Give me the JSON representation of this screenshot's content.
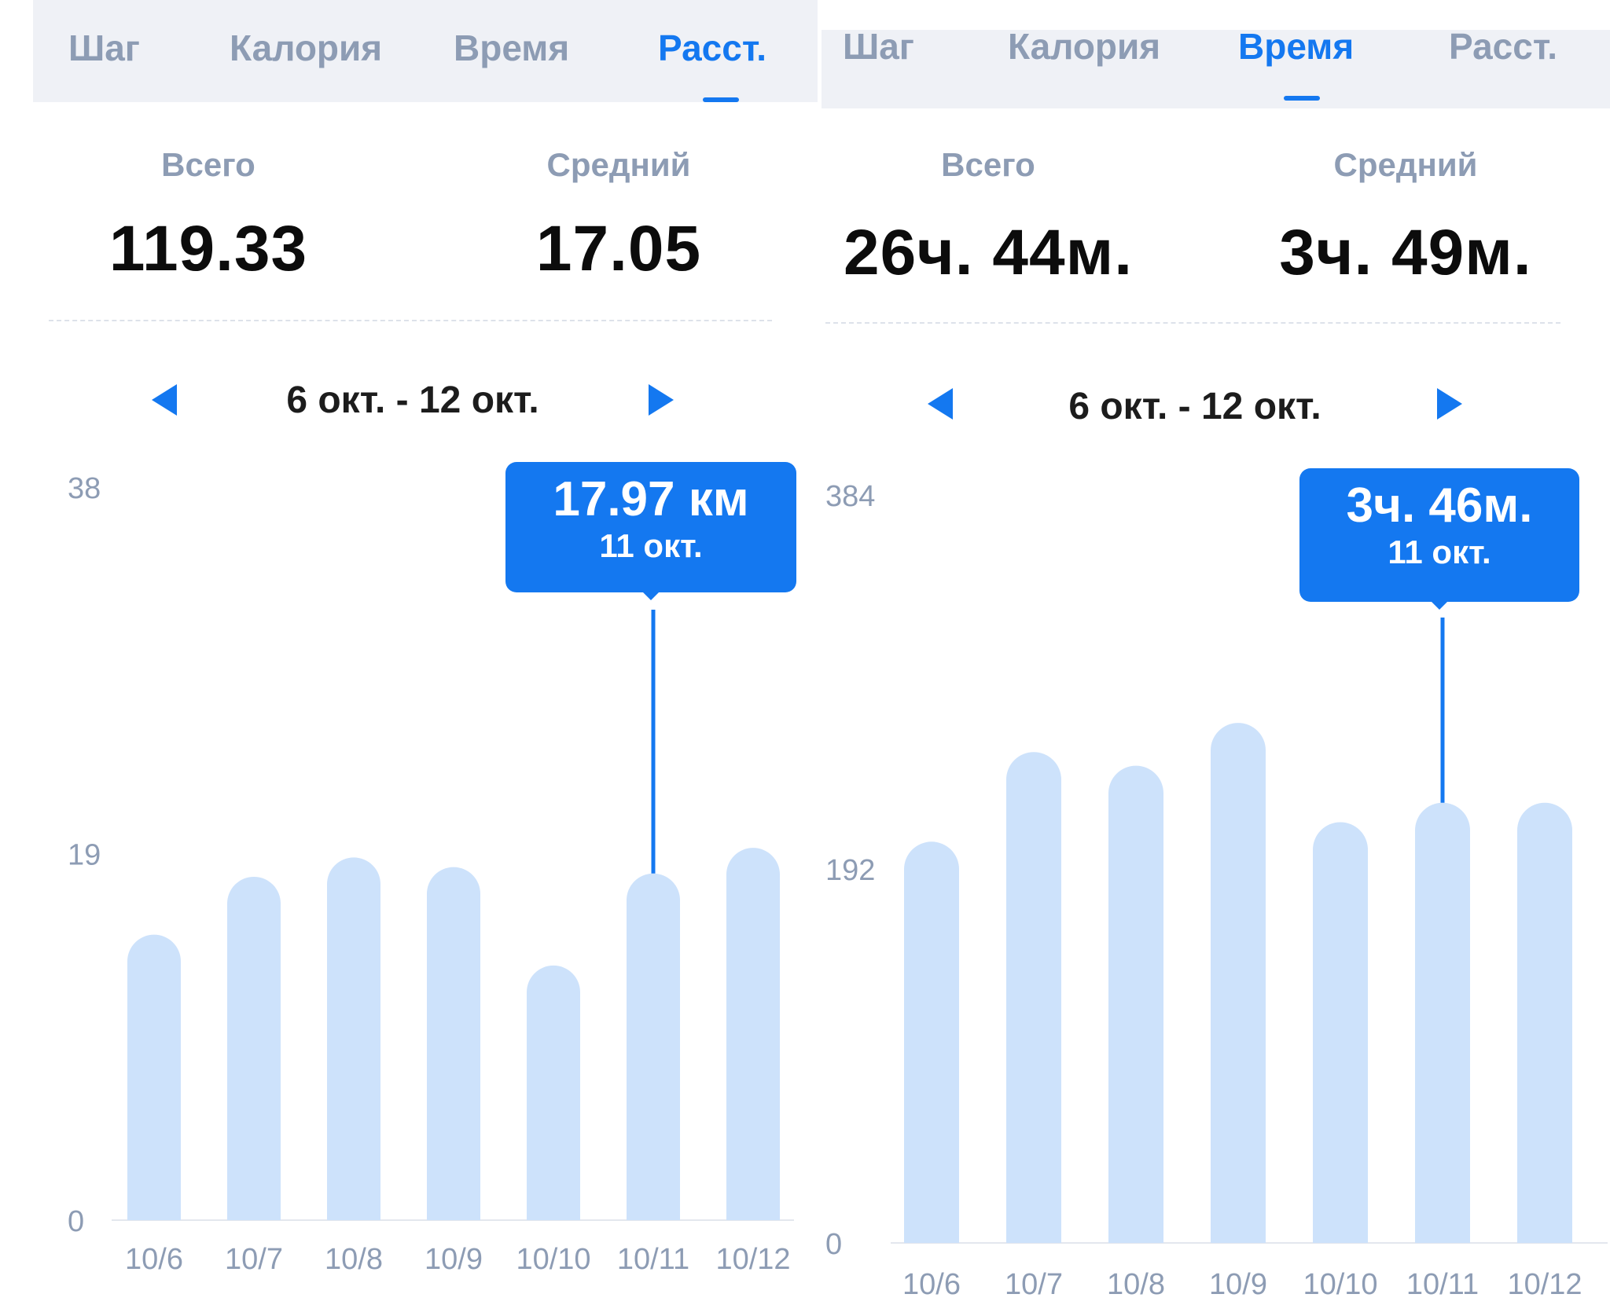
{
  "colors": {
    "accent": "#1478f0",
    "bar": "#cde2fb",
    "axis_text": "#8d9cb4",
    "value_text": "#0c0c0c",
    "tab_bg": "#eff1f6"
  },
  "panels": [
    {
      "tabs": [
        {
          "label": "Шаг",
          "active": false
        },
        {
          "label": "Калория",
          "active": false
        },
        {
          "label": "Время",
          "active": false
        },
        {
          "label": "Расст.",
          "active": true
        }
      ],
      "stats": {
        "total_label": "Всего",
        "total_value": "119.33",
        "avg_label": "Средний",
        "avg_value": "17.05"
      },
      "range_label": "6 окт. - 12 окт.",
      "tooltip": {
        "value": "17.97 км",
        "date": "11 окт."
      }
    },
    {
      "tabs": [
        {
          "label": "Шаг",
          "active": false
        },
        {
          "label": "Калория",
          "active": false
        },
        {
          "label": "Время",
          "active": true
        },
        {
          "label": "Расст.",
          "active": false
        }
      ],
      "stats": {
        "total_label": "Всего",
        "total_value": "26ч. 44м.",
        "avg_label": "Средний",
        "avg_value": "3ч. 49м."
      },
      "range_label": "6 окт. - 12 окт.",
      "tooltip": {
        "value": "3ч. 46м.",
        "date": "11 окт."
      }
    }
  ],
  "chart_data": [
    {
      "type": "bar",
      "categories": [
        "10/6",
        "10/7",
        "10/8",
        "10/9",
        "10/10",
        "10/11",
        "10/12"
      ],
      "values": [
        14.8,
        17.8,
        18.8,
        18.3,
        13.2,
        17.97,
        19.3
      ],
      "yticks": [
        "0",
        "19",
        "38"
      ],
      "ylim": [
        0,
        38
      ],
      "highlighted_index": 5,
      "grid": false
    },
    {
      "type": "bar",
      "categories": [
        "10/6",
        "10/7",
        "10/8",
        "10/9",
        "10/10",
        "10/11",
        "10/12"
      ],
      "values": [
        206,
        252,
        245,
        267,
        216,
        226,
        226
      ],
      "yticks": [
        "0",
        "192",
        "384"
      ],
      "ylim": [
        0,
        384
      ],
      "highlighted_index": 5,
      "grid": false
    }
  ]
}
